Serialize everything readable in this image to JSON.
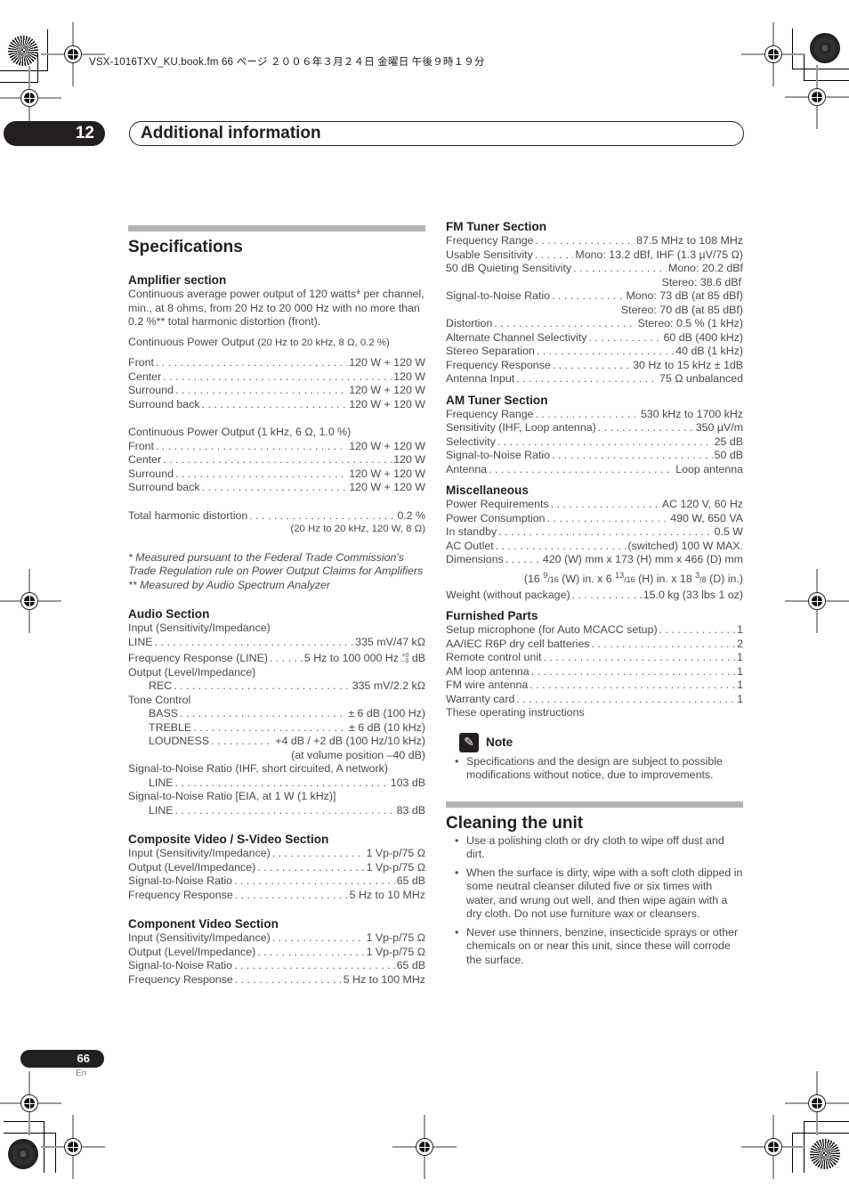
{
  "file_header": "VSX-1016TXV_KU.book.fm  66 ページ  ２００６年３月２４日  金曜日  午後９時１９分",
  "chapter": {
    "number": "12",
    "title": "Additional information"
  },
  "specifications": {
    "title": "Specifications",
    "amplifier": {
      "title": "Amplifier section",
      "intro": "Continuous average power output of 120 watts* per channel, min., at 8 ohms, from 20 Hz to 20 000 Hz with no more than 0.2 %** total harmonic distortion (front).",
      "cpo1_label": "Continuous Power Output",
      "cpo1_cond": "(20 Hz to 20 kHz, 8 Ω, 0.2 %)",
      "cpo1_rows": [
        {
          "label": "Front",
          "value": "120 W + 120 W"
        },
        {
          "label": "Center",
          "value": "120 W"
        },
        {
          "label": "Surround",
          "value": "120 W + 120 W"
        },
        {
          "label": "Surround back",
          "value": "120 W + 120 W"
        }
      ],
      "cpo2_label": "Continuous Power Output (1 kHz, 6 Ω, 1.0 %)",
      "cpo2_rows": [
        {
          "label": "Front",
          "value": "120 W + 120 W"
        },
        {
          "label": "Center",
          "value": "120 W"
        },
        {
          "label": "Surround",
          "value": "120 W + 120 W"
        },
        {
          "label": "Surround back",
          "value": "120 W + 120 W"
        }
      ],
      "thd": {
        "label": "Total harmonic distortion",
        "value": "0.2 %",
        "cond": "(20 Hz to 20 kHz, 120 W, 8 Ω)"
      },
      "footnote1": "* Measured pursuant to the Federal Trade Commission's Trade Regulation rule on Power Output Claims for Amplifiers",
      "footnote2": "** Measured by Audio Spectrum Analyzer"
    },
    "audio": {
      "title": "Audio Section",
      "input_label": "Input (Sensitivity/Impedance)",
      "line_input": {
        "label": "LINE",
        "value": "335 mV/47 kΩ"
      },
      "freq_resp": {
        "label": "Frequency Response (LINE)",
        "value": "5 Hz to 100 000 Hz",
        "tol_plus": "+0",
        "tol_minus": "–3",
        "unit": "dB"
      },
      "output_label": "Output (Level/Impedance)",
      "rec": {
        "label": "REC",
        "value": "335 mV/2.2 kΩ"
      },
      "tone_label": "Tone Control",
      "tone_rows": [
        {
          "label": "BASS",
          "value": "± 6 dB (100 Hz)"
        },
        {
          "label": "TREBLE",
          "value": "± 6 dB (10 kHz)"
        },
        {
          "label": "LOUDNESS",
          "value": "+4 dB / +2 dB (100 Hz/10 kHz)"
        }
      ],
      "loudness_cond": "(at volume position –40 dB)",
      "snr1_label": "Signal-to-Noise Ratio (IHF, short circuited, A network)",
      "snr1_line": {
        "label": "LINE",
        "value": "103 dB"
      },
      "snr2_label": "Signal-to-Noise Ratio [EIA, at 1 W (1 kHz)]",
      "snr2_line": {
        "label": "LINE",
        "value": "83 dB"
      }
    },
    "composite": {
      "title": "Composite Video / S-Video Section",
      "rows": [
        {
          "label": "Input (Sensitivity/Impedance)",
          "value": "1 Vp-p/75 Ω"
        },
        {
          "label": "Output (Level/Impedance)",
          "value": "1 Vp-p/75 Ω"
        },
        {
          "label": "Signal-to-Noise Ratio",
          "value": "65 dB"
        },
        {
          "label": "Frequency Response",
          "value": "5 Hz to 10 MHz"
        }
      ]
    },
    "component": {
      "title": "Component Video Section",
      "rows": [
        {
          "label": "Input (Sensitivity/Impedance)",
          "value": "1 Vp-p/75 Ω"
        },
        {
          "label": "Output (Level/Impedance)",
          "value": "1 Vp-p/75 Ω"
        },
        {
          "label": "Signal-to-Noise Ratio",
          "value": "65 dB"
        },
        {
          "label": "Frequency Response",
          "value": "5 Hz to 100 MHz"
        }
      ]
    },
    "fm": {
      "title": "FM Tuner Section",
      "rows": [
        {
          "label": "Frequency Range",
          "value": "87.5 MHz to 108 MHz"
        },
        {
          "label": "Usable Sensitivity",
          "value": "Mono: 13.2 dBf, IHF (1.3 µV/75 Ω)"
        },
        {
          "label": "50 dB Quieting Sensitivity",
          "value": "Mono: 20.2 dBf"
        }
      ],
      "quieting_stereo": "Stereo: 38.6 dBf",
      "snr": {
        "label": "Signal-to-Noise Ratio",
        "value": "Mono: 73 dB (at 85 dBf)"
      },
      "snr_stereo": "Stereo: 70 dB (at 85 dBf)",
      "rows2": [
        {
          "label": "Distortion",
          "value": "Stereo: 0.5 % (1 kHz)"
        },
        {
          "label": "Alternate Channel Selectivity",
          "value": "60 dB (400 kHz)"
        },
        {
          "label": "Stereo Separation",
          "value": "40 dB (1 kHz)"
        },
        {
          "label": "Frequency Response",
          "value": "30 Hz to 15 kHz ± 1dB"
        },
        {
          "label": "Antenna Input",
          "value": "75 Ω unbalanced"
        }
      ]
    },
    "am": {
      "title": "AM Tuner Section",
      "rows": [
        {
          "label": "Frequency Range",
          "value": "530 kHz to 1700 kHz"
        },
        {
          "label": "Sensitivity (IHF, Loop antenna)",
          "value": "350 µV/m"
        },
        {
          "label": "Selectivity",
          "value": "25 dB"
        },
        {
          "label": "Signal-to-Noise Ratio",
          "value": "50 dB"
        },
        {
          "label": "Antenna",
          "value": "Loop antenna"
        }
      ]
    },
    "misc": {
      "title": "Miscellaneous",
      "rows": [
        {
          "label": "Power Requirements",
          "value": "AC 120 V, 60 Hz"
        },
        {
          "label": "Power Consumption",
          "value": "490 W, 650 VA"
        },
        {
          "label": "In standby",
          "value": "0.5 W"
        },
        {
          "label": "AC Outlet",
          "value": "(switched) 100 W MAX."
        },
        {
          "label": "Dimensions",
          "value": "420 (W) mm x 173 (H) mm x 466 (D) mm"
        }
      ],
      "dim_inches": {
        "w_whole": "16 ",
        "w_num": "9",
        "w_den": "/16",
        "w_rest": " (W) in. x 6 ",
        "h_num": "13",
        "h_den": "/16",
        "h_rest": " (H) in. x 18 ",
        "d_num": "3",
        "d_den": "/8",
        "d_rest": " (D) in.)",
        "open": "("
      },
      "weight": {
        "label": "Weight (without package)",
        "value": "15.0 kg (33 lbs 1 oz)"
      }
    },
    "furnished": {
      "title": "Furnished Parts",
      "rows": [
        {
          "label": "Setup microphone (for Auto MCACC setup)",
          "value": "1"
        },
        {
          "label": "AA/IEC R6P dry cell batteries",
          "value": "2"
        },
        {
          "label": "Remote control unit",
          "value": "1"
        },
        {
          "label": "AM loop antenna",
          "value": "1"
        },
        {
          "label": "FM wire antenna",
          "value": "1"
        },
        {
          "label": "Warranty card",
          "value": "1"
        }
      ],
      "last": "These operating instructions"
    },
    "note": {
      "label": "Note",
      "items": [
        "Specifications and the design are subject to possible modifications without notice, due to improvements."
      ]
    }
  },
  "cleaning": {
    "title": "Cleaning the unit",
    "items": [
      "Use a polishing cloth or dry cloth to wipe off dust and dirt.",
      "When the surface is dirty, wipe with a soft cloth dipped in some neutral cleanser diluted five or six times with water, and wrung out well, and then wipe again with a dry cloth. Do not use furniture wax or cleansers.",
      "Never use thinners, benzine, insecticide sprays or other chemicals on or near this unit, since these will corrode the surface."
    ]
  },
  "footer": {
    "page_number": "66",
    "language": "En"
  }
}
